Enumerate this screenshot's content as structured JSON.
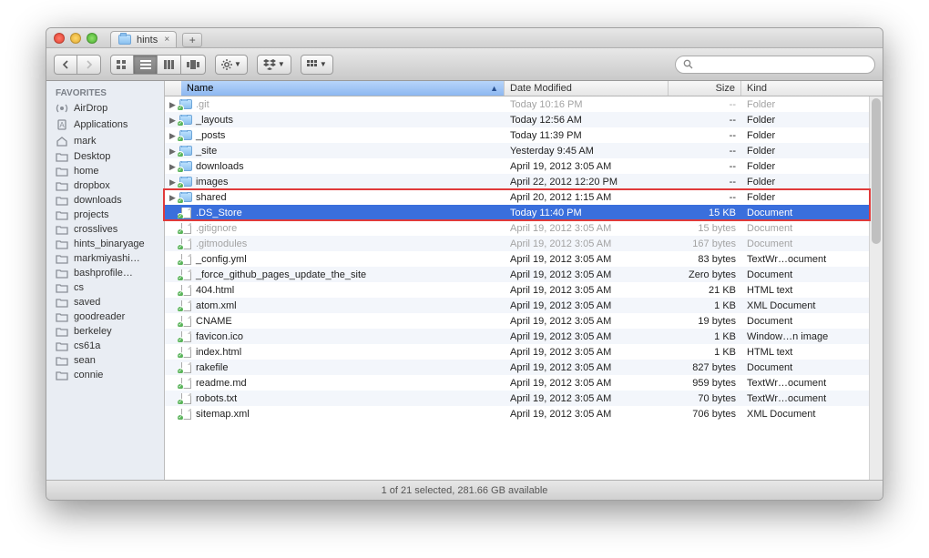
{
  "window": {
    "title": "hints"
  },
  "sidebar": {
    "header": "FAVORITES",
    "items": [
      {
        "label": "AirDrop",
        "icon": "airdrop"
      },
      {
        "label": "Applications",
        "icon": "apps"
      },
      {
        "label": "mark",
        "icon": "home"
      },
      {
        "label": "Desktop",
        "icon": "folder"
      },
      {
        "label": "home",
        "icon": "folder"
      },
      {
        "label": "dropbox",
        "icon": "folder"
      },
      {
        "label": "downloads",
        "icon": "folder"
      },
      {
        "label": "projects",
        "icon": "folder"
      },
      {
        "label": "crosslives",
        "icon": "folder"
      },
      {
        "label": "hints_binaryage",
        "icon": "folder"
      },
      {
        "label": "markmiyashi…",
        "icon": "folder"
      },
      {
        "label": "bashprofile…",
        "icon": "folder"
      },
      {
        "label": "cs",
        "icon": "folder"
      },
      {
        "label": "saved",
        "icon": "folder"
      },
      {
        "label": "goodreader",
        "icon": "folder"
      },
      {
        "label": "berkeley",
        "icon": "folder"
      },
      {
        "label": "cs61a",
        "icon": "folder"
      },
      {
        "label": "sean",
        "icon": "folder"
      },
      {
        "label": "connie",
        "icon": "folder"
      }
    ]
  },
  "columns": {
    "name": "Name",
    "date": "Date Modified",
    "size": "Size",
    "kind": "Kind"
  },
  "rows": [
    {
      "name": ".git",
      "date": "Today 10:16 PM",
      "size": "--",
      "kind": "Folder",
      "type": "folder",
      "dim": true,
      "expand": true
    },
    {
      "name": "_layouts",
      "date": "Today 12:56 AM",
      "size": "--",
      "kind": "Folder",
      "type": "folder",
      "expand": true
    },
    {
      "name": "_posts",
      "date": "Today 11:39 PM",
      "size": "--",
      "kind": "Folder",
      "type": "folder",
      "expand": true
    },
    {
      "name": "_site",
      "date": "Yesterday 9:45 AM",
      "size": "--",
      "kind": "Folder",
      "type": "folder",
      "expand": true
    },
    {
      "name": "downloads",
      "date": "April 19, 2012 3:05 AM",
      "size": "--",
      "kind": "Folder",
      "type": "folder",
      "expand": true
    },
    {
      "name": "images",
      "date": "April 22, 2012 12:20 PM",
      "size": "--",
      "kind": "Folder",
      "type": "folder",
      "expand": true
    },
    {
      "name": "shared",
      "date": "April 20, 2012 1:15 AM",
      "size": "--",
      "kind": "Folder",
      "type": "folder",
      "expand": true
    },
    {
      "name": ".DS_Store",
      "date": "Today 11:40 PM",
      "size": "15 KB",
      "kind": "Document",
      "type": "file",
      "dim": true,
      "selected": true
    },
    {
      "name": ".gitignore",
      "date": "April 19, 2012 3:05 AM",
      "size": "15 bytes",
      "kind": "Document",
      "type": "file",
      "dim": true
    },
    {
      "name": ".gitmodules",
      "date": "April 19, 2012 3:05 AM",
      "size": "167 bytes",
      "kind": "Document",
      "type": "file",
      "dim": true
    },
    {
      "name": "_config.yml",
      "date": "April 19, 2012 3:05 AM",
      "size": "83 bytes",
      "kind": "TextWr…ocument",
      "type": "file"
    },
    {
      "name": "_force_github_pages_update_the_site",
      "date": "April 19, 2012 3:05 AM",
      "size": "Zero bytes",
      "kind": "Document",
      "type": "file"
    },
    {
      "name": "404.html",
      "date": "April 19, 2012 3:05 AM",
      "size": "21 KB",
      "kind": "HTML text",
      "type": "file"
    },
    {
      "name": "atom.xml",
      "date": "April 19, 2012 3:05 AM",
      "size": "1 KB",
      "kind": "XML Document",
      "type": "file"
    },
    {
      "name": "CNAME",
      "date": "April 19, 2012 3:05 AM",
      "size": "19 bytes",
      "kind": "Document",
      "type": "file"
    },
    {
      "name": "favicon.ico",
      "date": "April 19, 2012 3:05 AM",
      "size": "1 KB",
      "kind": "Window…n image",
      "type": "file"
    },
    {
      "name": "index.html",
      "date": "April 19, 2012 3:05 AM",
      "size": "1 KB",
      "kind": "HTML text",
      "type": "file"
    },
    {
      "name": "rakefile",
      "date": "April 19, 2012 3:05 AM",
      "size": "827 bytes",
      "kind": "Document",
      "type": "file"
    },
    {
      "name": "readme.md",
      "date": "April 19, 2012 3:05 AM",
      "size": "959 bytes",
      "kind": "TextWr…ocument",
      "type": "file"
    },
    {
      "name": "robots.txt",
      "date": "April 19, 2012 3:05 AM",
      "size": "70 bytes",
      "kind": "TextWr…ocument",
      "type": "file"
    },
    {
      "name": "sitemap.xml",
      "date": "April 19, 2012 3:05 AM",
      "size": "706 bytes",
      "kind": "XML Document",
      "type": "file"
    }
  ],
  "status": "1 of 21 selected, 281.66 GB available",
  "search": {
    "placeholder": ""
  }
}
